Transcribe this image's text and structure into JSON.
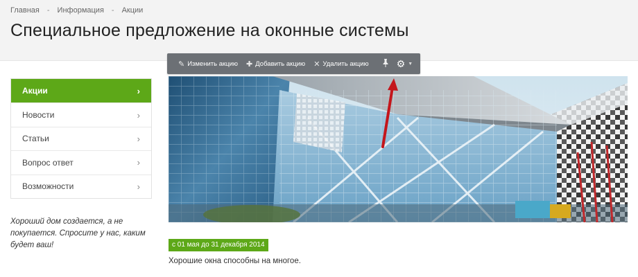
{
  "breadcrumb": {
    "items": [
      "Главная",
      "Информация",
      "Акции"
    ],
    "separator": "-"
  },
  "page_title": "Специальное предложение на оконные системы",
  "toolbar": {
    "edit_label": "Изменить акцию",
    "add_label": "Добавить акцию",
    "delete_label": "Удалить акцию",
    "icons": [
      "pencil-icon",
      "plus-icon",
      "close-icon",
      "pin-icon",
      "gear-icon"
    ]
  },
  "sidebar": {
    "items": [
      {
        "label": "Акции",
        "active": true
      },
      {
        "label": "Новости",
        "active": false
      },
      {
        "label": "Статьи",
        "active": false
      },
      {
        "label": "Вопрос ответ",
        "active": false
      },
      {
        "label": "Возможности",
        "active": false
      }
    ],
    "quote": "Хороший дом создается, а не покупается. Спросите у нас, каким будет ваш!"
  },
  "promo": {
    "date_badge": "с 01 мая до 31 декабря 2014",
    "lead_text": "Хорошие окна способны на многое."
  },
  "colors": {
    "accent_green": "#5da818",
    "toolbar_bg": "#6c7075",
    "arrow_red": "#c4161c"
  }
}
